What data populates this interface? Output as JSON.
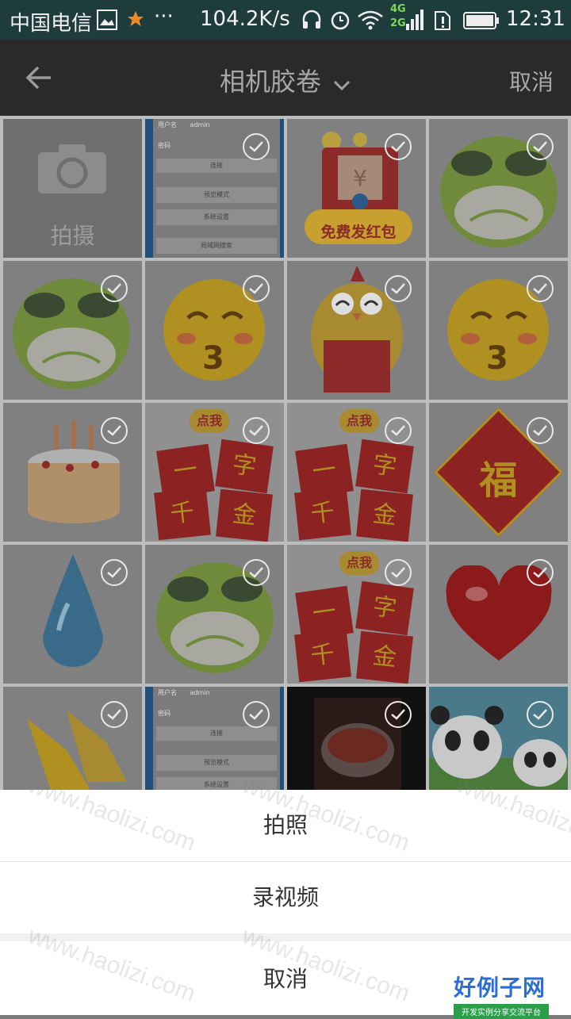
{
  "status_bar": {
    "carrier": "中国电信",
    "speed": "104.2K/s",
    "signal_4g": "4G",
    "signal_2g": "2G",
    "time": "12:31"
  },
  "app_bar": {
    "title": "相机胶卷",
    "cancel": "取消"
  },
  "grid": {
    "camera_label": "拍摄",
    "screenshot_user_label": "用户名",
    "screenshot_user_value": "admin",
    "screenshot_password_label": "密码",
    "screenshot_login": "连接",
    "screenshot_preview": "预览模式",
    "screenshot_settings": "系统设置",
    "screenshot_lan": "局域网搜索",
    "redpacket_text": "免费发红包",
    "click_me": "点我",
    "fu": "福",
    "char_yi": "一",
    "char_zi": "字",
    "char_qian": "千",
    "char_jin": "金"
  },
  "sheet": {
    "take_photo": "拍照",
    "record_video": "录视频",
    "cancel": "取消"
  },
  "brand": {
    "name": "好例子网",
    "tagline": "开发实例分享交流平台"
  },
  "watermark": "www.haolizi.com",
  "colors": {
    "status_bar": "#1f3c3c",
    "app_bar": "#2a2a2a",
    "frog": "#8bc34a",
    "emoji": "#f5c400",
    "red": "#d32f2f"
  }
}
